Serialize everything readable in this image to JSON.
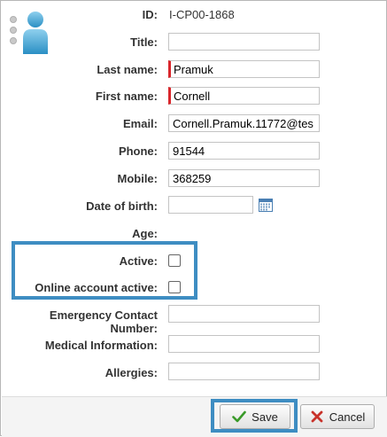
{
  "form": {
    "id_label": "ID:",
    "id_value": "I-CP00-1868",
    "title_label": "Title:",
    "title_value": "",
    "last_name_label": "Last name:",
    "last_name_value": "Pramuk",
    "first_name_label": "First name:",
    "first_name_value": "Cornell",
    "email_label": "Email:",
    "email_value": "Cornell.Pramuk.11772@tes",
    "phone_label": "Phone:",
    "phone_value": "91544",
    "mobile_label": "Mobile:",
    "mobile_value": "368259",
    "dob_label": "Date of birth:",
    "dob_value": "",
    "age_label": "Age:",
    "active_label": "Active:",
    "online_active_label": "Online account active:",
    "emergency_label_line1": "Emergency Contact",
    "emergency_label_line2": "Number:",
    "emergency_value": "",
    "medical_label": "Medical Information:",
    "medical_value": "",
    "allergies_label": "Allergies:",
    "allergies_value": ""
  },
  "footer": {
    "save_label": "Save",
    "cancel_label": "Cancel"
  },
  "colors": {
    "highlight": "#3e8dc2",
    "required_marker": "#d9262b",
    "save_check": "#3a9a2a",
    "cancel_x": "#c8322a"
  },
  "icons": {
    "avatar": "user-avatar-icon",
    "calendar": "calendar-icon",
    "save": "checkmark-icon",
    "cancel": "x-icon"
  }
}
